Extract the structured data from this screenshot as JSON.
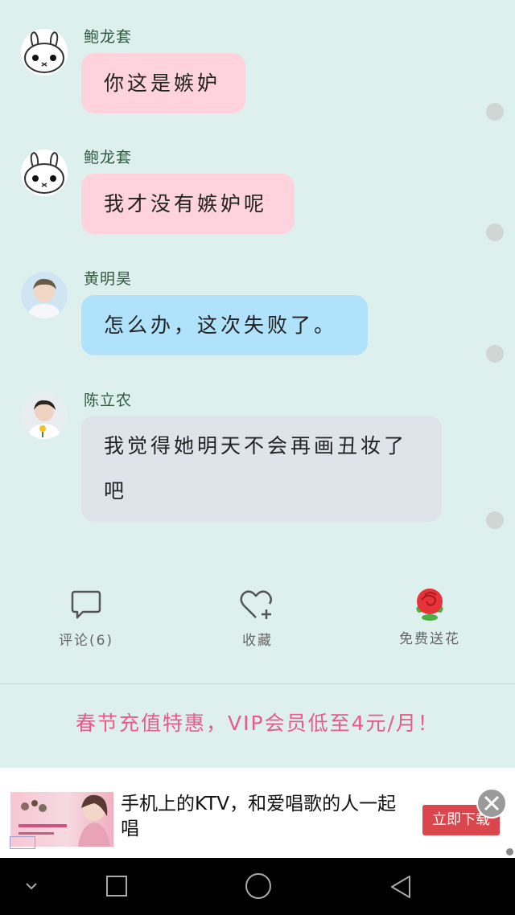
{
  "messages": [
    {
      "sender": "鲍龙套",
      "text": "你这是嫉妒",
      "color": "#ffd3dd",
      "avatar": "bunny-avatar"
    },
    {
      "sender": "鲍龙套",
      "text": "我才没有嫉妒呢",
      "color": "#ffd3dd",
      "avatar": "bunny-avatar"
    },
    {
      "sender": "黄明昊",
      "text": "怎么办，这次失败了。",
      "color": "#b1e2fb",
      "avatar": "person-avatar"
    },
    {
      "sender": "陈立农",
      "text": "我觉得她明天不会再画丑妆了吧",
      "color": "#dee4ea",
      "avatar": "person-avatar"
    }
  ],
  "actions": {
    "comment_label": "评论(6)",
    "favorite_label": "收藏",
    "flower_label": "免费送花"
  },
  "promo": {
    "text": "春节充值特惠，VIP会员低至4元/月！",
    "color": "#e85b88"
  },
  "ad": {
    "text": "手机上的KTV，和爱唱歌的人一起唱",
    "button_label": "立即下载",
    "button_color": "#d9464b"
  },
  "icons": {
    "comment": "comment-bubble-icon",
    "favorite": "heart-plus-icon",
    "flower": "rose-icon",
    "close": "close-icon",
    "nav": [
      "chevron-down-icon",
      "square-icon",
      "circle-icon",
      "triangle-back-icon"
    ]
  }
}
